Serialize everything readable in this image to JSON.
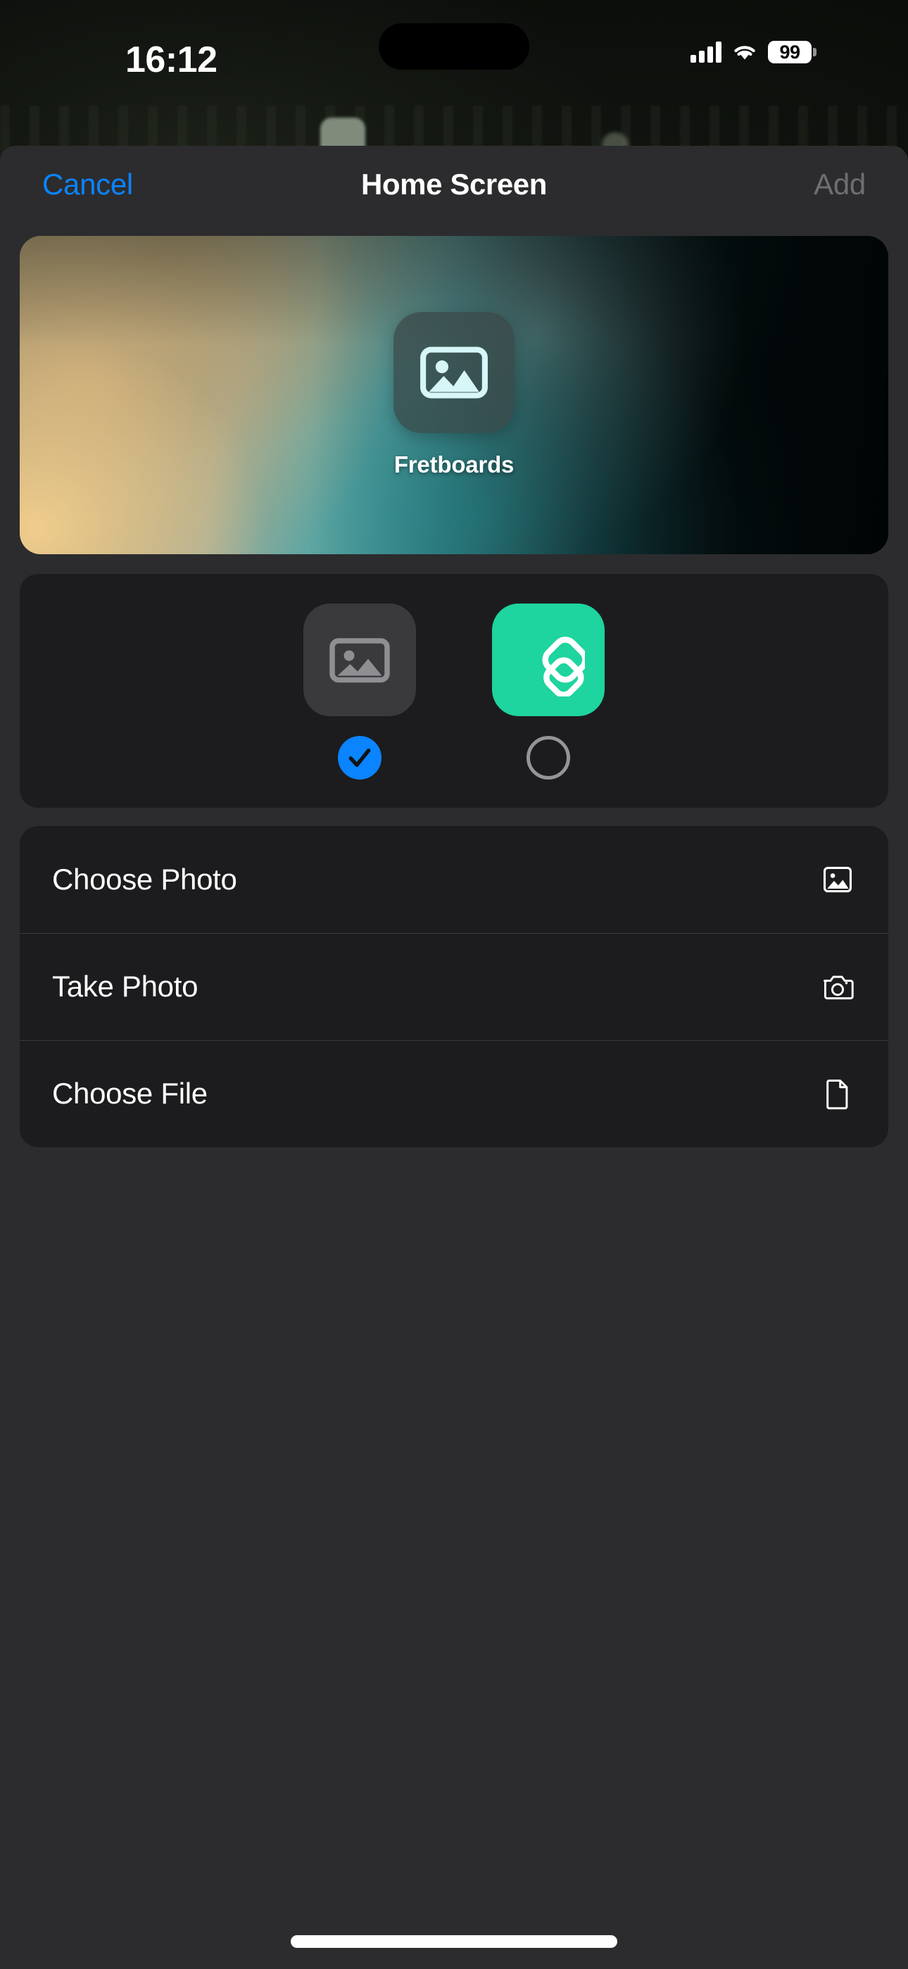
{
  "status_bar": {
    "time": "16:12",
    "battery_percent": "99",
    "cellular_icon": "cellular-bars-icon",
    "wifi_icon": "wifi-icon",
    "battery_icon": "battery-icon"
  },
  "nav": {
    "cancel_label": "Cancel",
    "title": "Home Screen",
    "add_label": "Add",
    "add_disabled": true
  },
  "preview": {
    "app_label": "Fretboards",
    "icon_name": "photo-placeholder-icon",
    "wallpaper": {
      "colors": [
        "#f0cd8c",
        "#9a8a67",
        "#4fa1a4",
        "#10363c",
        "#050a0b"
      ]
    }
  },
  "icon_picker": {
    "options": [
      {
        "id": "placeholder",
        "icon_name": "photo-placeholder-icon",
        "tile_color": "#3a3a3c",
        "selected": true
      },
      {
        "id": "brand",
        "icon_name": "layers-stack-icon",
        "tile_color": "#1ed49f",
        "selected": false
      }
    ],
    "selected_color": "#0a84ff",
    "unselected_stroke": "#949499"
  },
  "actions": [
    {
      "label": "Choose Photo",
      "icon_name": "photo-icon"
    },
    {
      "label": "Take Photo",
      "icon_name": "camera-icon"
    },
    {
      "label": "Choose File",
      "icon_name": "document-icon"
    }
  ],
  "colors": {
    "accent_blue": "#0a84ff",
    "sheet_background": "#2c2c2e",
    "card_background": "#1c1c1e",
    "separator": "#3a3a3c",
    "brand_green": "#1ed49f",
    "disabled_text": "#6e6e73"
  }
}
